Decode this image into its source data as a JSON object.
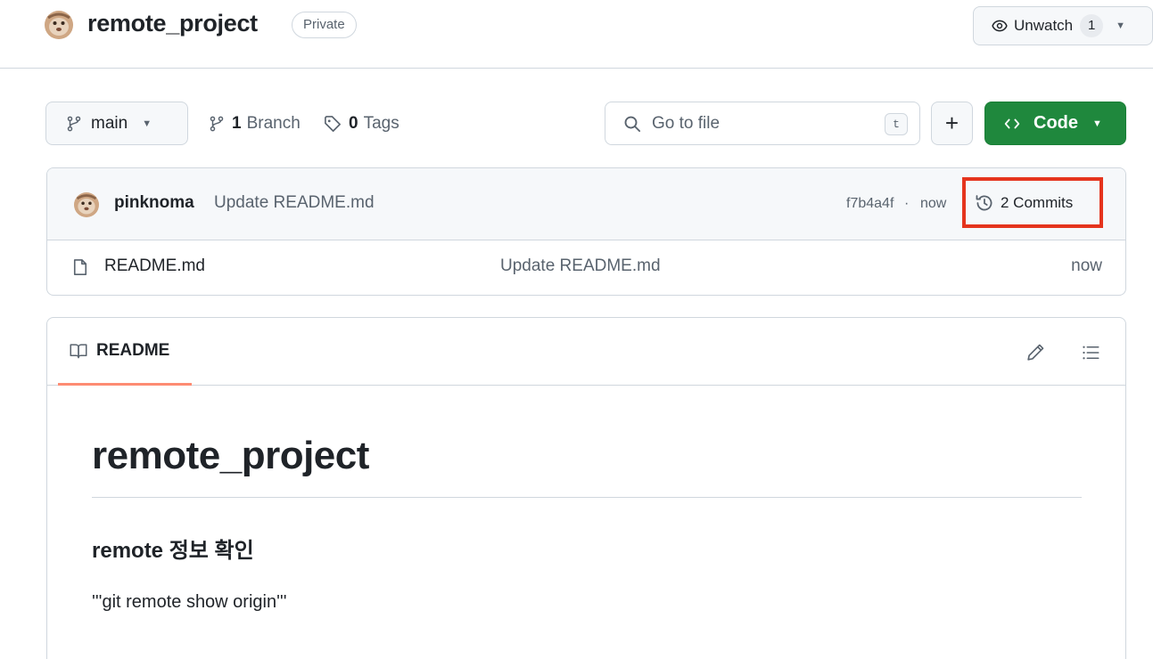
{
  "repo": {
    "name": "remote_project",
    "visibility": "Private",
    "avatar_icon": "user-avatar-icon"
  },
  "header_actions": {
    "unwatch_label": "Unwatch",
    "watch_count": "1"
  },
  "toolbar": {
    "branch_name": "main",
    "branches_count": "1",
    "branches_label": "Branch",
    "tags_count": "0",
    "tags_label": "Tags",
    "search_placeholder": "Go to file",
    "search_shortcut": "t",
    "add_label": "+",
    "code_label": "Code"
  },
  "latest_commit": {
    "author": "pinknoma",
    "message": "Update README.md",
    "sha": "f7b4a4f",
    "separator": "·",
    "time": "now",
    "commits_label": "2 Commits"
  },
  "files": [
    {
      "name": "README.md",
      "commit_message": "Update README.md",
      "time": "now"
    }
  ],
  "readme": {
    "tab_label": "README",
    "h1": "remote_project",
    "h2": "remote 정보 확인",
    "paragraph": "'''git remote show origin'''"
  },
  "colors": {
    "accent_green": "#1f883d",
    "highlight_red": "#e5341d",
    "tab_underline": "#fd8c73",
    "border": "#d0d7de",
    "muted_text": "#59636e"
  }
}
